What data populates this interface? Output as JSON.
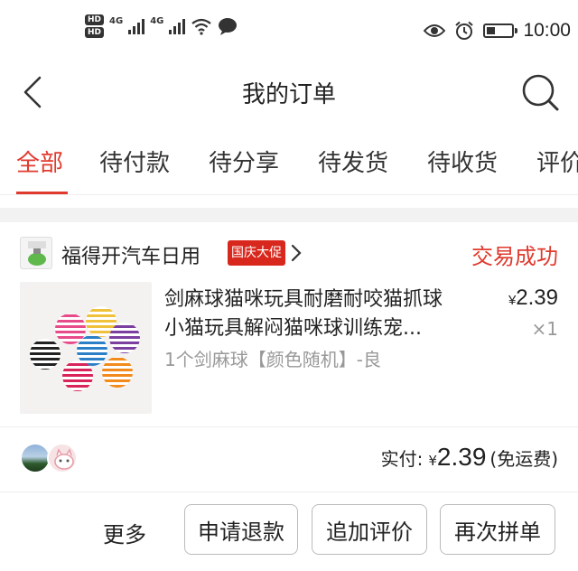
{
  "status_bar": {
    "hd1": "HD",
    "hd2": "HD",
    "net1": "4G",
    "net2": "4G",
    "time": "10:00",
    "icons": [
      "signal-icon",
      "wifi-icon",
      "chat-bubble-icon",
      "eye-icon",
      "alarm-icon",
      "battery-icon"
    ],
    "battery_level": 0.35
  },
  "header": {
    "title": "我的订单",
    "back_icon": "chevron-left-icon",
    "search_icon": "search-icon"
  },
  "tabs": [
    {
      "label": "全部",
      "active": true
    },
    {
      "label": "待付款",
      "active": false
    },
    {
      "label": "待分享",
      "active": false
    },
    {
      "label": "待发货",
      "active": false
    },
    {
      "label": "待收货",
      "active": false
    },
    {
      "label": "评价",
      "active": false
    }
  ],
  "order": {
    "shop_name": "福得开汽车日用",
    "promo_badge": "国庆大促",
    "status": "交易成功",
    "product": {
      "name_line1": "剑麻球猫咪玩具耐磨耐咬猫抓球",
      "name_line2": "小猫玩具解闷猫咪球训练宠...",
      "variant": "1个剑麻球【颜色随机】-良",
      "price_symbol": "¥",
      "price": "2.39",
      "quantity": "×1"
    },
    "payment": {
      "label": "实付:",
      "symbol": "¥",
      "amount": "2.39",
      "shipping": "(免运费)"
    },
    "actions": {
      "more": "更多",
      "refund": "申请退款",
      "add_review": "追加评价",
      "rebuy": "再次拼单"
    }
  },
  "colors": {
    "accent": "#e03a2e",
    "promo_bg": "#d8281d",
    "muted": "#999999"
  }
}
